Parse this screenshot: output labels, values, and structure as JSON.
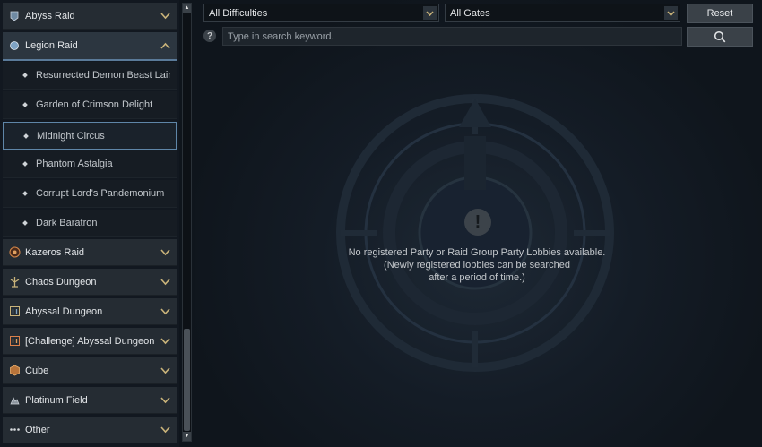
{
  "sidebar": {
    "categories": [
      {
        "label": "Abyss Raid",
        "icon": "abyss-raid-icon"
      },
      {
        "label": "Legion Raid",
        "icon": "legion-raid-icon"
      },
      {
        "label": "Kazeros Raid",
        "icon": "kazeros-raid-icon"
      },
      {
        "label": "Chaos Dungeon",
        "icon": "chaos-dungeon-icon"
      },
      {
        "label": "Abyssal Dungeon",
        "icon": "abyssal-dungeon-icon"
      },
      {
        "label": "[Challenge] Abyssal Dungeon",
        "icon": "challenge-abyssal-dungeon-icon"
      },
      {
        "label": "Cube",
        "icon": "cube-icon"
      },
      {
        "label": "Platinum Field",
        "icon": "platinum-field-icon"
      },
      {
        "label": "Other",
        "icon": "more-dots-icon"
      }
    ],
    "legion_raid_items": [
      "Resurrected Demon Beast Lair",
      "Garden of Crimson Delight",
      "Midnight Circus",
      "Phantom Astalgia",
      "Corrupt Lord's Pandemonium",
      "Dark Baratron"
    ],
    "selected_item": "Midnight Circus"
  },
  "filters": {
    "difficulty": "All Difficulties",
    "gates": "All Gates",
    "reset_label": "Reset",
    "search_placeholder": "Type in search keyword."
  },
  "empty_state": {
    "line1": "No registered Party or Raid Group Party Lobbies available.",
    "line2": "(Newly registered lobbies can be searched",
    "line3": "after a period of time.)"
  },
  "colors": {
    "accent_gold": "#c9b37a",
    "selection_border": "#5f86a8",
    "background": "#0f151c"
  }
}
